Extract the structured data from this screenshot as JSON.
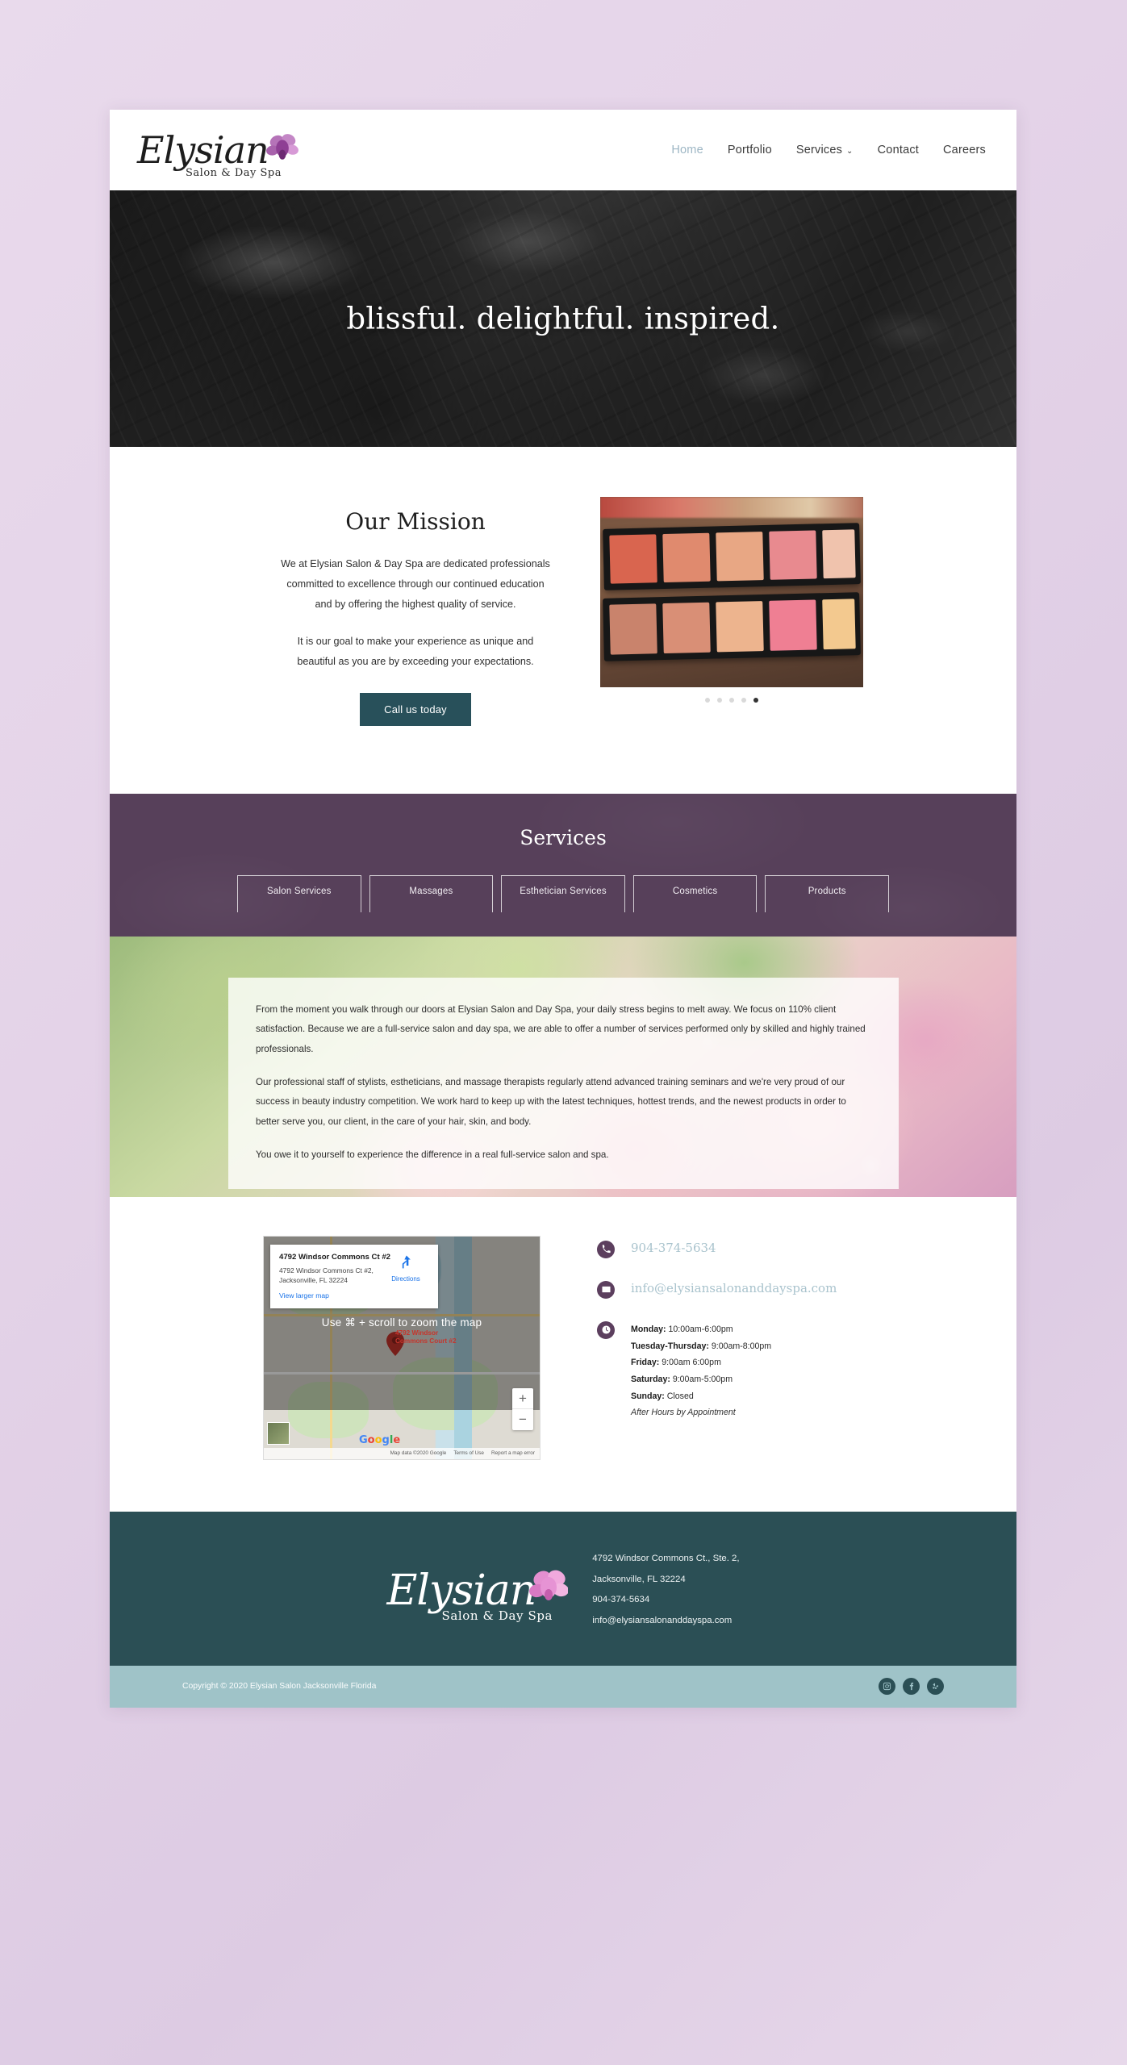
{
  "site": {
    "logo_text": "Elysian",
    "logo_sub": "Salon & Day Spa"
  },
  "nav": {
    "items": [
      {
        "label": "Home",
        "active": true
      },
      {
        "label": "Portfolio",
        "active": false
      },
      {
        "label": "Services",
        "active": false,
        "has_dropdown": true
      },
      {
        "label": "Contact",
        "active": false
      },
      {
        "label": "Careers",
        "active": false
      }
    ],
    "caret": "⌄"
  },
  "hero": {
    "title": "blissful. delightful. inspired."
  },
  "mission": {
    "title": "Our Mission",
    "paragraph1": "We at Elysian Salon & Day Spa are dedicated professionals committed to excellence through our continued education and by offering the highest quality of service.",
    "paragraph2": "It is our goal to make your experience as unique and beautiful as you are by exceeding your expectations.",
    "cta_label": "Call us today",
    "carousel": {
      "total_dots": 5,
      "active_index": 4
    }
  },
  "services": {
    "title": "Services",
    "tabs": [
      {
        "label": "Salon Services"
      },
      {
        "label": "Massages"
      },
      {
        "label": "Esthetician Services"
      },
      {
        "label": "Cosmetics"
      },
      {
        "label": "Products"
      }
    ],
    "accent_bg": "#57405a"
  },
  "about": {
    "paragraph1": "From the moment you walk through our doors at Elysian Salon and Day Spa, your daily stress begins to melt away. We focus on 110% client satisfaction. Because we are a full-service salon and day spa, we are able to offer a number of services performed only by skilled and highly trained professionals.",
    "paragraph2": "Our professional staff of stylists, estheticians, and massage therapists regularly attend advanced training seminars and we're very proud of our success in beauty industry competition. We work hard to keep up with the latest techniques, hottest trends, and the newest products in order to better serve you, our client, in the care of your hair, skin, and body.",
    "paragraph3": "You owe it to yourself to experience the difference in a real full-service salon and spa."
  },
  "map": {
    "card_title": "4792 Windsor Commons Ct #2",
    "card_address_line1": "4792 Windsor Commons Ct #2,",
    "card_address_line2": "Jacksonville, FL 32224",
    "view_larger": "View larger map",
    "directions_label": "Directions",
    "zoom_hint": "Use ⌘ + scroll to zoom the map",
    "pin_label_line1": "4792 Windsor",
    "pin_label_line2": "Commons Court #2",
    "zoom_in": "+",
    "zoom_out": "−",
    "attrib_data": "Map data ©2020 Google",
    "attrib_terms": "Terms of Use",
    "attrib_report": "Report a map error",
    "google_letters": [
      "G",
      "o",
      "o",
      "g",
      "l",
      "e"
    ]
  },
  "contact": {
    "phone": "904-374-5634",
    "email": "info@elysiansalonanddayspa.com",
    "hours": [
      {
        "day": "Monday:",
        "time": "10:00am-6:00pm"
      },
      {
        "day": "Tuesday-Thursday:",
        "time": "9:00am-8:00pm"
      },
      {
        "day": "Friday:",
        "time": "9:00am 6:00pm"
      },
      {
        "day": "Saturday:",
        "time": "9:00am-5:00pm"
      },
      {
        "day": "Sunday:",
        "time": "Closed"
      }
    ],
    "after_hours": "After Hours by Appointment"
  },
  "footer": {
    "logo_text": "Elysian",
    "logo_sub": "Salon & Day Spa",
    "address_line1": "4792 Windsor Commons Ct., Ste. 2,",
    "address_line2": "Jacksonville, FL 32224",
    "phone": "904-374-5634",
    "email": "info@elysiansalonanddayspa.com",
    "bg_color": "#2b4f55"
  },
  "copybar": {
    "text": "Copyright © 2020 Elysian Salon Jacksonville Florida",
    "bg_color": "#9fc3c8",
    "socials": [
      "instagram-icon",
      "facebook-icon",
      "yelp-icon"
    ]
  }
}
